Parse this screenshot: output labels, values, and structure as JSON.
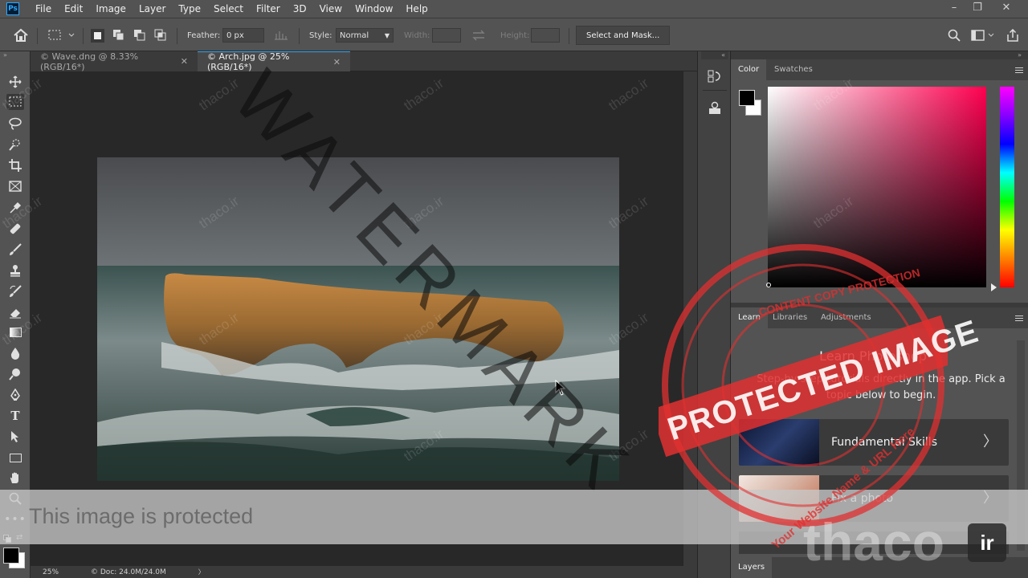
{
  "app": {
    "logo": "Ps"
  },
  "menu": [
    "File",
    "Edit",
    "Image",
    "Layer",
    "Type",
    "Select",
    "Filter",
    "3D",
    "View",
    "Window",
    "Help"
  ],
  "window_controls": {
    "minimize": "–",
    "restore": "❐",
    "close": "✕"
  },
  "options": {
    "feather_label": "Feather:",
    "feather_value": "0 px",
    "style_label": "Style:",
    "style_value": "Normal",
    "width_label": "Width:",
    "height_label": "Height:",
    "select_mask_button": "Select and Mask..."
  },
  "tabs": [
    {
      "label": "© Wave.dng @ 8.33% (RGB/16*)",
      "close": "✕",
      "active": false
    },
    {
      "label": "© Arch.jpg @ 25% (RGB/16*)",
      "close": "✕",
      "active": true
    }
  ],
  "tools": [
    "move-icon",
    "marquee-icon",
    "lasso-icon",
    "quick-select-icon",
    "crop-icon",
    "frame-icon",
    "eyedropper-icon",
    "healing-icon",
    "brush-icon",
    "stamp-icon",
    "history-brush-icon",
    "eraser-icon",
    "gradient-icon",
    "blur-icon",
    "dodge-icon",
    "pen-icon",
    "type-icon",
    "path-select-icon",
    "rectangle-icon",
    "hand-icon",
    "zoom-icon",
    "more-icon"
  ],
  "status": {
    "zoom": "25%",
    "doc_info": "© Doc: 24.0M/24.0M",
    "arrow": "〉"
  },
  "color_panel": {
    "tabs": [
      "Color",
      "Swatches"
    ],
    "active": "Color",
    "hue_color": "#ff0050"
  },
  "learn_panel": {
    "tabs": [
      "Learn",
      "Libraries",
      "Adjustments"
    ],
    "active": "Learn",
    "title": "Learn Photoshop",
    "description": "Step-by-step tutorials directly in the app. Pick a topic below to begin.",
    "cards": [
      {
        "label": "Fundamental Skills",
        "chevron": "〉"
      },
      {
        "label": "Fix a photo",
        "chevron": "〉"
      }
    ]
  },
  "layers_panel": {
    "tabs": [
      "Layers"
    ]
  },
  "overlay": {
    "protected_banner": "This image is protected",
    "stamp_top": "CONTENT COPY PROTECTION",
    "stamp_main": "PROTECTED IMAGE",
    "stamp_bottom": "Your Website Name & URL Here",
    "big_watermark": "WATERMARK",
    "small_watermark": "thaco.ir",
    "logo_text": "thaco",
    "logo_badge": "ir"
  },
  "colors": {
    "accent": "#31a8ff",
    "stamp_red": "#e03030"
  }
}
